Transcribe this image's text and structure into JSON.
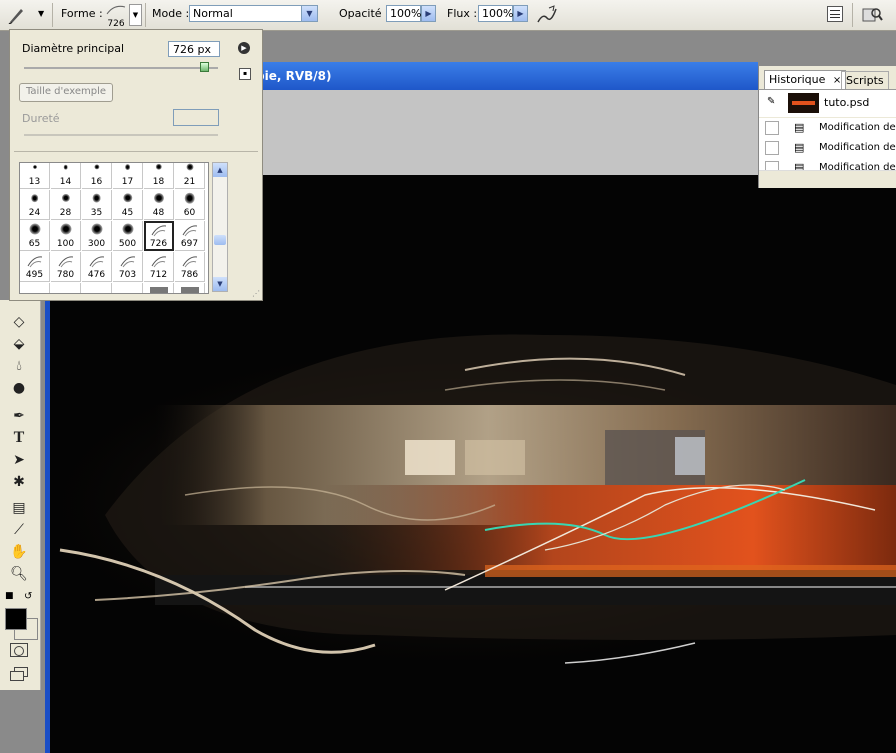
{
  "options_bar": {
    "brush_label": "Forme :",
    "brush_size": "726",
    "mode_label": "Mode :",
    "mode_value": "Normal",
    "opacity_label": "Opacité :",
    "opacity_value": "100%",
    "flow_label": "Flux :",
    "flow_value": "100%"
  },
  "document": {
    "title_fragment": "pie, RVB/8)"
  },
  "brush_picker": {
    "master_diameter_label": "Diamètre principal",
    "master_diameter_value": "726 px",
    "sample_size_button": "Taille d'exemple",
    "hardness_label": "Dureté",
    "presets": [
      {
        "size": "13",
        "kind": "round"
      },
      {
        "size": "14",
        "kind": "round"
      },
      {
        "size": "16",
        "kind": "round"
      },
      {
        "size": "17",
        "kind": "round"
      },
      {
        "size": "18",
        "kind": "round"
      },
      {
        "size": "21",
        "kind": "round"
      },
      {
        "size": "24",
        "kind": "round"
      },
      {
        "size": "28",
        "kind": "round"
      },
      {
        "size": "35",
        "kind": "round"
      },
      {
        "size": "45",
        "kind": "round"
      },
      {
        "size": "48",
        "kind": "round"
      },
      {
        "size": "60",
        "kind": "round"
      },
      {
        "size": "65",
        "kind": "round"
      },
      {
        "size": "100",
        "kind": "round"
      },
      {
        "size": "300",
        "kind": "round"
      },
      {
        "size": "500",
        "kind": "round"
      },
      {
        "size": "726",
        "kind": "custom"
      },
      {
        "size": "697",
        "kind": "custom"
      },
      {
        "size": "495",
        "kind": "custom"
      },
      {
        "size": "780",
        "kind": "custom"
      },
      {
        "size": "476",
        "kind": "custom"
      },
      {
        "size": "703",
        "kind": "custom"
      },
      {
        "size": "712",
        "kind": "custom"
      },
      {
        "size": "786",
        "kind": "custom"
      }
    ],
    "selected_preset": "726"
  },
  "history_panel": {
    "tabs": [
      "Historique",
      "Scripts"
    ],
    "snapshot_name": "tuto.psd",
    "entries": [
      "Modification de la",
      "Modification de la",
      "Modification de la"
    ]
  },
  "colors": {
    "foreground": "#000000",
    "background": "#ffffff",
    "title_bar": "#1f57c9",
    "canvas_bg": "#040404"
  }
}
